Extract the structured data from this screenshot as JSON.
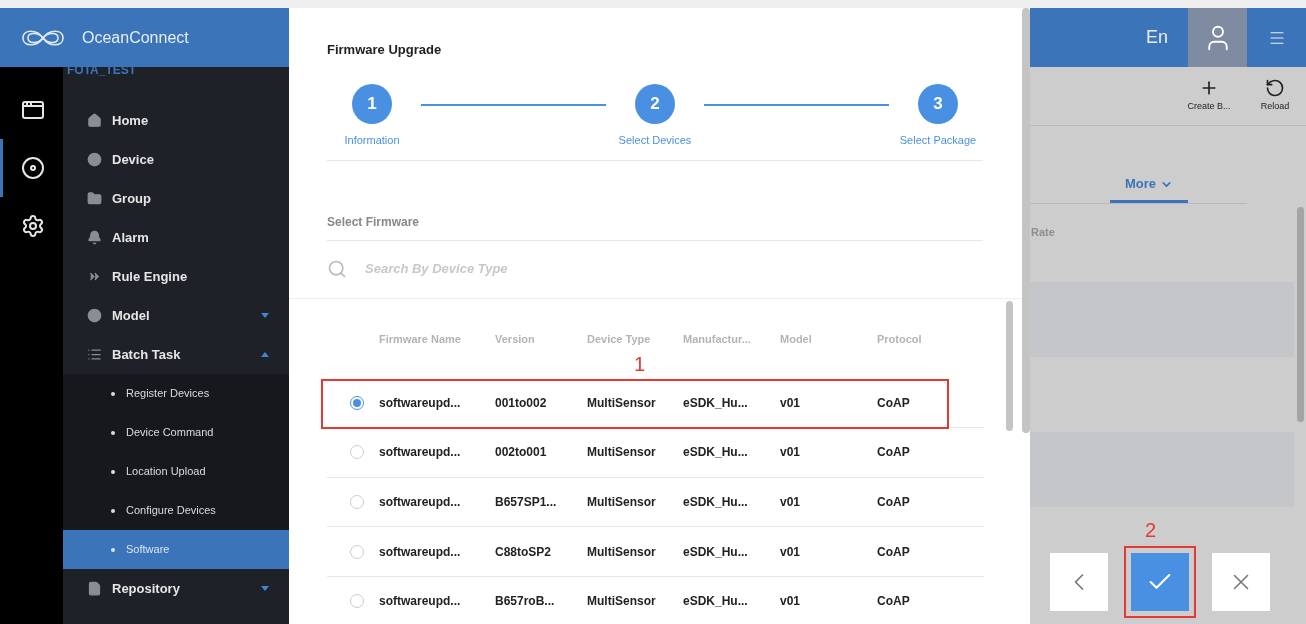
{
  "header": {
    "brand": "OceanConnect",
    "language": "En"
  },
  "rail": [
    {
      "kind": "windows",
      "selected": false
    },
    {
      "kind": "device",
      "selected": true
    },
    {
      "kind": "settings",
      "selected": false
    }
  ],
  "sidebar": {
    "app_name": "FOTA_TEST",
    "items": [
      {
        "kind": "home",
        "label": "Home"
      },
      {
        "kind": "device",
        "label": "Device"
      },
      {
        "kind": "group",
        "label": "Group"
      },
      {
        "kind": "alarm",
        "label": "Alarm"
      },
      {
        "kind": "rule",
        "label": "Rule Engine"
      },
      {
        "kind": "model",
        "label": "Model",
        "expanded": false
      },
      {
        "kind": "batch",
        "label": "Batch Task",
        "expanded": true,
        "children": [
          {
            "label": "Register Devices",
            "selected": false
          },
          {
            "label": "Device Command",
            "selected": false
          },
          {
            "label": "Location Upload",
            "selected": false
          },
          {
            "label": "Configure Devices",
            "selected": false
          },
          {
            "label": "Software",
            "selected": true
          }
        ]
      },
      {
        "kind": "repository",
        "label": "Repository",
        "expanded": false
      }
    ]
  },
  "dialog": {
    "title": "Firmware Upgrade",
    "steps": [
      {
        "number": "1",
        "label": "Information"
      },
      {
        "number": "2",
        "label": "Select Devices"
      },
      {
        "number": "3",
        "label": "Select Package"
      }
    ],
    "section_title": "Select Firmware",
    "search": {
      "placeholder": "Search By Device Type"
    },
    "table": {
      "columns": [
        "Firmware Name",
        "Version",
        "Device Type",
        "Manufactur...",
        "Model",
        "Protocol"
      ],
      "rows": [
        {
          "selected": true,
          "cells": [
            "softwareupd...",
            "001to002",
            "MultiSensor",
            "eSDK_Hu...",
            "v01",
            "CoAP"
          ]
        },
        {
          "selected": false,
          "cells": [
            "softwareupd...",
            "002to001",
            "MultiSensor",
            "eSDK_Hu...",
            "v01",
            "CoAP"
          ]
        },
        {
          "selected": false,
          "cells": [
            "softwareupd...",
            "B657SP1...",
            "MultiSensor",
            "eSDK_Hu...",
            "v01",
            "CoAP"
          ]
        },
        {
          "selected": false,
          "cells": [
            "softwareupd...",
            "C88toSP2",
            "MultiSensor",
            "eSDK_Hu...",
            "v01",
            "CoAP"
          ]
        },
        {
          "selected": false,
          "cells": [
            "softwareupd...",
            "B657roB...",
            "MultiSensor",
            "eSDK_Hu...",
            "v01",
            "CoAP"
          ]
        }
      ]
    }
  },
  "background_page": {
    "toolbar": [
      {
        "kind": "add",
        "label": "Create B..."
      },
      {
        "kind": "reload",
        "label": "Reload"
      }
    ],
    "tab": "More",
    "column": "Rate"
  },
  "annotations": [
    {
      "label": "1"
    },
    {
      "label": "2"
    }
  ]
}
